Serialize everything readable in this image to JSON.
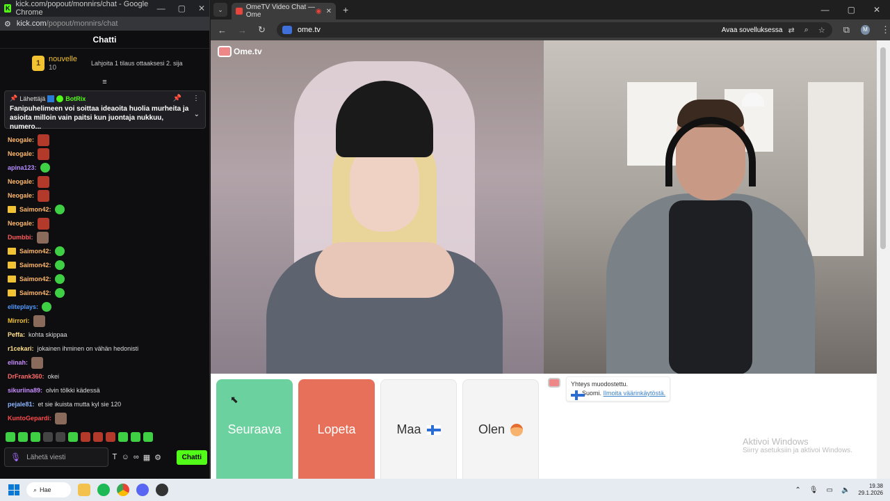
{
  "left_window": {
    "title": "kick.com/popout/monnirs/chat - Google Chrome",
    "url_domain": "kick.com",
    "url_path": "/popout/monnirs/chat",
    "chat_header": "Chatti",
    "leaderboard": {
      "rank": "1",
      "name": "nouvelle",
      "count": "10",
      "gift_text": "Lahjoita 1 tilaus ottaaksesi 2. sija"
    },
    "pinned": {
      "label": "Lähettäjä",
      "sender": "BotRix",
      "text": "Fanipuhelimeen voi soittaa ideaoita huolia murheita ja asioita milloin vain paitsi kun juontaja nukkuu, numero..."
    },
    "messages": [
      {
        "user": "Neogale:",
        "color": "#ffb86b",
        "text": "",
        "emote": "red"
      },
      {
        "user": "Neogale:",
        "color": "#ffb86b",
        "text": "",
        "emote": "red"
      },
      {
        "user": "apina123:",
        "color": "#b58cff",
        "text": "",
        "emote": "grn"
      },
      {
        "user": "Neogale:",
        "color": "#ffb86b",
        "text": "",
        "emote": "red"
      },
      {
        "user": "Neogale:",
        "color": "#ffb86b",
        "text": "",
        "emote": "red"
      },
      {
        "user": "Saimon42:",
        "color": "#ffb86b",
        "text": "",
        "emote": "grn",
        "crown": true
      },
      {
        "user": "Neogale:",
        "color": "#ffb86b",
        "text": "",
        "emote": "red"
      },
      {
        "user": "Dumbbi:",
        "color": "#ff5a5a",
        "text": "",
        "emote": "pic"
      },
      {
        "user": "Saimon42:",
        "color": "#ffb86b",
        "text": "",
        "emote": "grn",
        "crown": true
      },
      {
        "user": "Saimon42:",
        "color": "#ffb86b",
        "text": "",
        "emote": "grn",
        "crown": true
      },
      {
        "user": "Saimon42:",
        "color": "#ffb86b",
        "text": "",
        "emote": "grn",
        "crown": true
      },
      {
        "user": "Saimon42:",
        "color": "#ffb86b",
        "text": "",
        "emote": "grn",
        "crown": true
      },
      {
        "user": "eliteplays:",
        "color": "#4f9bff",
        "text": "",
        "emote": "grn"
      },
      {
        "user": "Mirrori:",
        "color": "#f1c232",
        "text": "",
        "emote": "pic"
      },
      {
        "user": "Peffa:",
        "color": "#ffe08a",
        "text": "kohta skippaa",
        "emote": ""
      },
      {
        "user": "r1cekari:",
        "color": "#ffe08a",
        "text": "jokainen ihminen on vähän hedonisti",
        "emote": ""
      },
      {
        "user": "elinah:",
        "color": "#c78cff",
        "text": "",
        "emote": "pic"
      },
      {
        "user": "DrFrank360:",
        "color": "#ff6a6a",
        "text": "okei",
        "emote": ""
      },
      {
        "user": "sikuriina89:",
        "color": "#c78cff",
        "text": "olvin tölkki kädessä",
        "emote": ""
      },
      {
        "user": "pejale81:",
        "color": "#8ab4ff",
        "text": "et sie ikuista mutta kyl sie 120",
        "emote": ""
      },
      {
        "user": "KuntoGepardi:",
        "color": "#ff4a4a",
        "text": "",
        "emote": "pic"
      }
    ],
    "input_placeholder": "Lähetä viesti",
    "send_label": "Chatti"
  },
  "right_window": {
    "tab_title": "OmeTV Video Chat — Ome",
    "url": "ome.tv",
    "open_app_label": "Avaa sovelluksessa",
    "logo_text": "Ome.tv",
    "buttons": {
      "next": "Seuraava",
      "stop": "Lopeta",
      "country": "Maa",
      "me": "Olen"
    },
    "system_msg": {
      "line1": "Yhteys muodostettu.",
      "country": "Suomi.",
      "report_link": "Ilmoita väärinkäytöstä."
    },
    "activate_windows": {
      "title": "Aktivoi Windows",
      "subtitle": "Siirry asetuksiin ja aktivoi Windows."
    }
  },
  "taskbar": {
    "search_label": "Hae",
    "time": "19.38",
    "date": "29.1.2026"
  }
}
